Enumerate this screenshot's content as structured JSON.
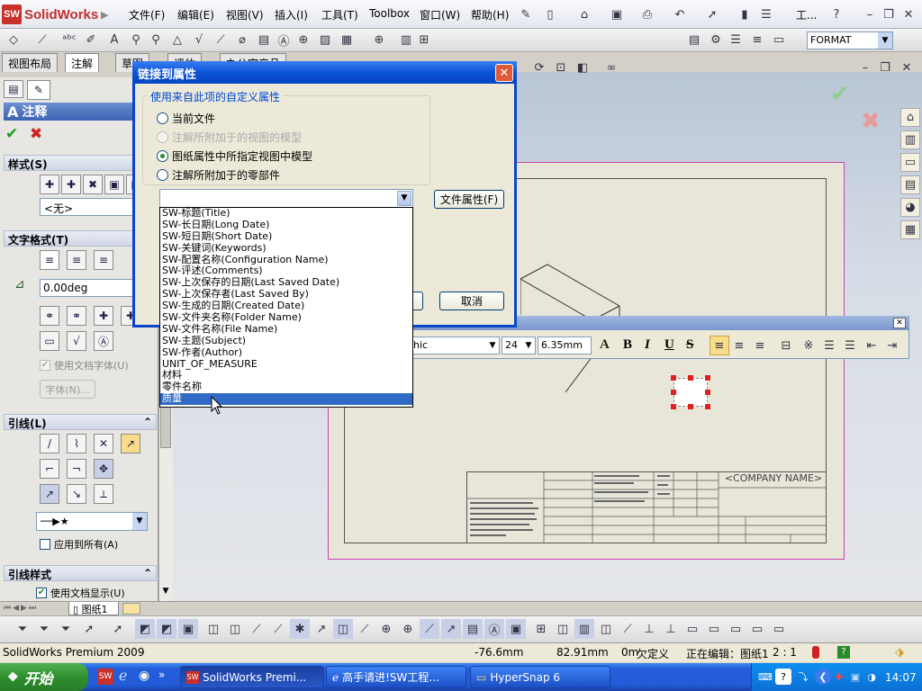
{
  "app": {
    "logo_text": "SolidWorks",
    "menu": [
      "文件(F)",
      "编辑(E)",
      "视图(V)",
      "插入(I)",
      "工具(T)",
      "Toolbox",
      "窗口(W)",
      "帮助(H)"
    ],
    "toolbar_more": "工...",
    "format_select": "FORMAT"
  },
  "manager_tabs": [
    "视图布局",
    "注解",
    "草图",
    "评估",
    "办公室产品"
  ],
  "annotation_panel": {
    "title": "注释",
    "style_section": "样式(S)",
    "style_value": "<无>",
    "text_format_section": "文字格式(T)",
    "angle_value": "0.00deg",
    "use_doc_font": "使用文档字体(U)",
    "font_button": "字体(N)...",
    "leader_section": "引线(L)",
    "apply_all": "应用到所有(A)",
    "leader_style_section": "引线样式",
    "use_doc_display": "使用文档显示(U)"
  },
  "dialog": {
    "title": "链接到属性",
    "group_label": "使用来自此项的自定义属性",
    "options": [
      {
        "label": "当前文件",
        "checked": false,
        "enabled": true
      },
      {
        "label": "注解所附加于的视图的模型",
        "checked": false,
        "enabled": false
      },
      {
        "label": "图纸属性中所指定视图中模型",
        "checked": true,
        "enabled": true
      },
      {
        "label": "注解所附加于的零部件",
        "checked": false,
        "enabled": true
      }
    ],
    "file_props_button": "文件属性(F)",
    "cancel_button": "取消",
    "dropdown_items": [
      "SW-标题(Title)",
      "SW-长日期(Long Date)",
      "SW-短日期(Short Date)",
      "SW-关键词(Keywords)",
      "SW-配置名称(Configuration Name)",
      "SW-评述(Comments)",
      "SW-上次保存的日期(Last Saved Date)",
      "SW-上次保存者(Last Saved By)",
      "SW-生成的日期(Created Date)",
      "SW-文件夹名称(Folder Name)",
      "SW-文件名称(File Name)",
      "SW-主题(Subject)",
      "SW-作者(Author)",
      "UNIT_OF_MEASURE",
      "材料",
      "零件名称",
      "质量"
    ],
    "selected_index": 16
  },
  "format_toolbar": {
    "font": "hic",
    "size": "24",
    "height": "6.35mm",
    "buttons": [
      "A",
      "B",
      "I",
      "U",
      "S"
    ]
  },
  "drawing": {
    "company_name": "<COMPANY NAME>"
  },
  "sheet_tab": "图纸1",
  "status": {
    "product": "SolidWorks Premium 2009",
    "x": "-76.6mm",
    "y": "82.91mm",
    "z": "0m",
    "constraint": "欠定义",
    "editing": "正在编辑：图纸1",
    "scale": "2 : 1"
  },
  "taskbar": {
    "start": "开始",
    "tasks": [
      "SolidWorks Premi...",
      "高手请进!SW工程...",
      "HyperSnap 6"
    ],
    "time": "14:07"
  }
}
